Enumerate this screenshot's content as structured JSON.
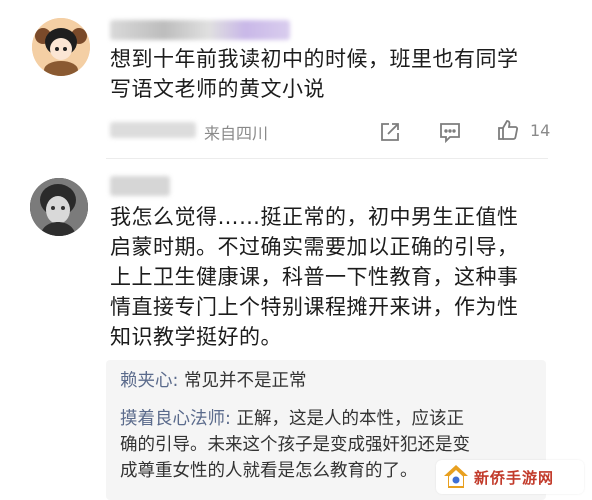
{
  "comments": [
    {
      "text_lines": [
        "想到十年前我读初中的时候，班里也有同学",
        "写语文老师的黄文小说"
      ],
      "location": "来自四川",
      "like_count": "14"
    },
    {
      "text_lines": [
        "我怎么觉得……挺正常的，初中男生正值性",
        "启蒙时期。不过确实需要加以正确的引导，",
        "上上卫生健康课，科普一下性教育，这种事",
        "情直接专门上个特别课程摊开来讲，作为性",
        "知识教学挺好的。"
      ],
      "replies": [
        {
          "author": "赖夹心",
          "lines": [
            "常见并不是正常"
          ]
        },
        {
          "author": "摸着良心法师",
          "lines": [
            "正解，这是人的本性，应该正",
            "确的引导。未来这个孩子是变成强奸犯还是变",
            "成尊重女性的人就看是怎么教育的了。"
          ]
        }
      ]
    }
  ],
  "icons": [
    "share-icon",
    "comment-icon",
    "like-icon"
  ],
  "watermark": {
    "text": "新侨手游网"
  }
}
